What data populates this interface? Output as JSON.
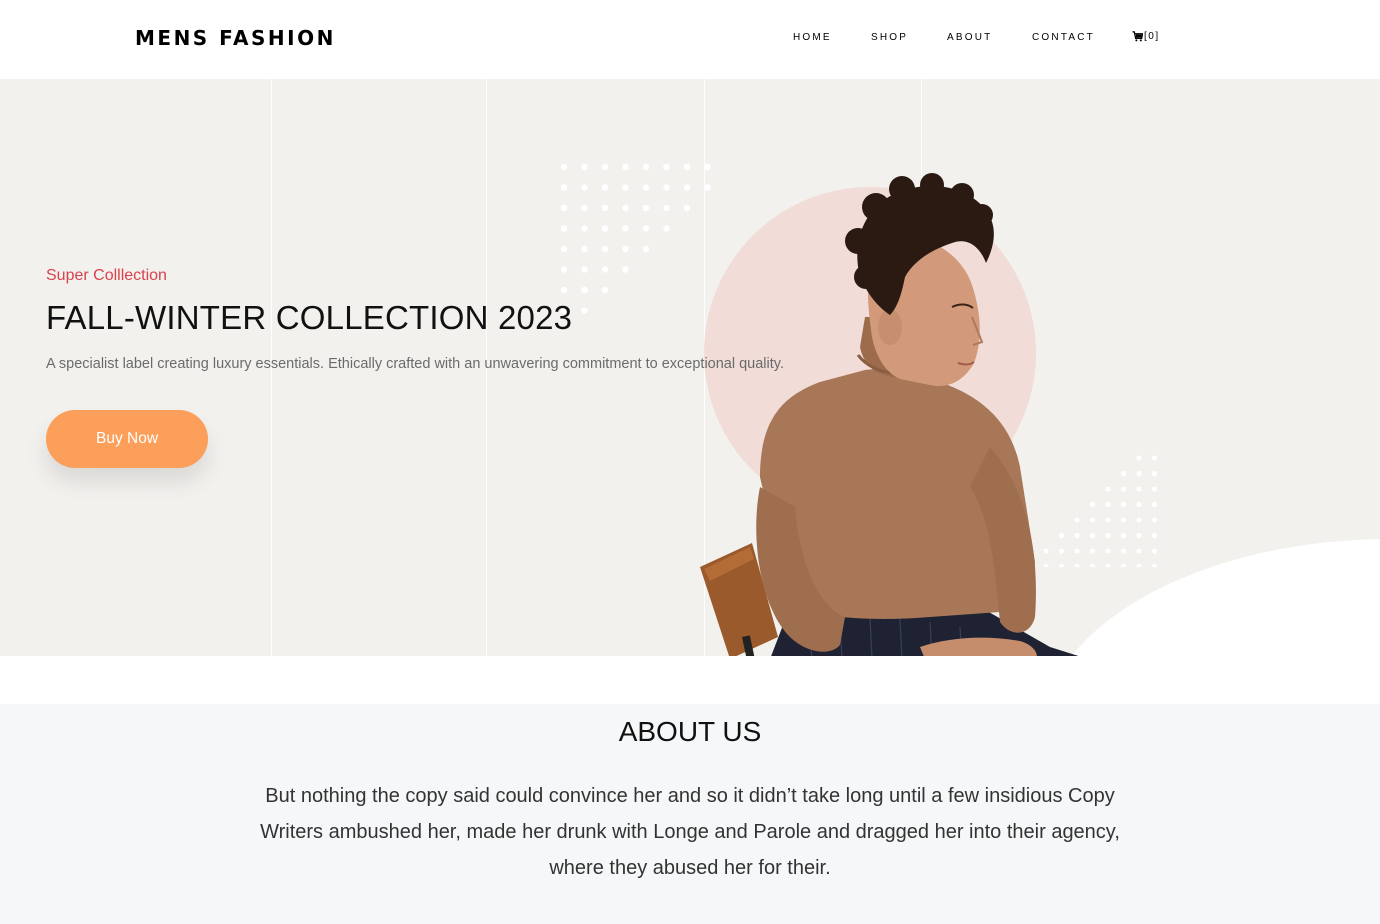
{
  "header": {
    "brand": "MENS FASHION",
    "nav": [
      "HOME",
      "SHOP",
      "ABOUT",
      "CONTACT"
    ],
    "cart_label": "[0]"
  },
  "hero": {
    "subtitle": "Super Colllection",
    "title": "FALL-WINTER COLLECTION 2023",
    "description": "A specialist label creating luxury essentials. Ethically crafted with an unwavering commitment to exceptional quality.",
    "button_label": "Buy Now"
  },
  "about": {
    "title": "ABOUT US",
    "text": "But nothing the copy said could convince her and so it didn’t take long until a few insidious Copy Writers ambushed her, made her drunk with Longe and Parole and dragged her into their agency, where they abused her for their."
  },
  "colors": {
    "accent": "#fb9f5a",
    "subtitle": "#d9424c",
    "hero_bg": "#f2f1ee",
    "about_bg": "#f6f7f8",
    "circle": "#f1dcd7"
  }
}
